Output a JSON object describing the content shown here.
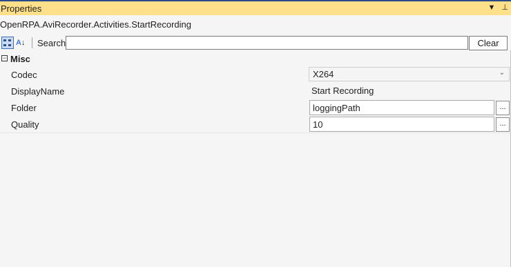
{
  "panel": {
    "title": "Properties",
    "pin_icon": "pin-icon",
    "dropdown_icon": "dropdown-arrow-icon",
    "type_name": "OpenRPA.AviRecorder.Activities.StartRecording"
  },
  "toolbar": {
    "categorized_icon": "categorized-view-icon",
    "alphabetical_icon": "alphabetical-sort-icon",
    "search_label": "Search:",
    "search_value": "",
    "clear_label": "Clear"
  },
  "category": {
    "expander_symbol": "−",
    "label": "Misc"
  },
  "properties": [
    {
      "name": "Codec",
      "value": "X264",
      "editor": "combo"
    },
    {
      "name": "DisplayName",
      "value": "Start Recording",
      "editor": "plain"
    },
    {
      "name": "Folder",
      "value": "loggingPath",
      "editor": "textbox",
      "button": "..."
    },
    {
      "name": "Quality",
      "value": "10",
      "editor": "textbox",
      "button": "..."
    }
  ],
  "colors": {
    "title_bg": "#fde089",
    "accent": "#29488a",
    "panel_bg": "#f5f5f5"
  }
}
